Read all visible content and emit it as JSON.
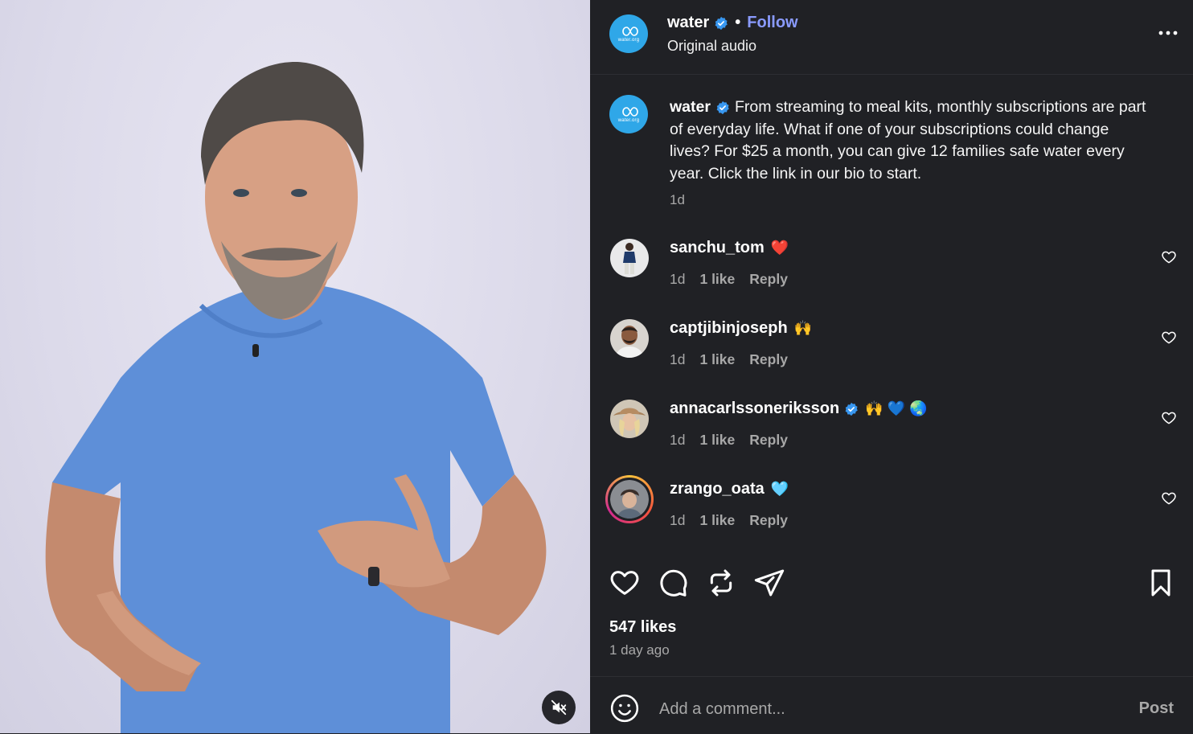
{
  "media": {
    "mute_icon": "speaker-muted-icon"
  },
  "header": {
    "username": "water",
    "separator": "•",
    "follow_label": "Follow",
    "audio": "Original audio",
    "avatar_wordmark": "water.org"
  },
  "caption": {
    "username": "water",
    "text": "From streaming to meal kits, monthly subscriptions are part of everyday life. What if one of your subscriptions could change lives? For $25 a month, you can give 12 families safe water every year. Click the link in our bio to start.",
    "time": "1d"
  },
  "comments": [
    {
      "username": "sanchu_tom",
      "text": "❤️",
      "time": "1d",
      "likes": "1 like",
      "reply": "Reply",
      "verified": false
    },
    {
      "username": "captjibinjoseph",
      "text": "🙌",
      "time": "1d",
      "likes": "1 like",
      "reply": "Reply",
      "verified": false
    },
    {
      "username": "annacarlssoneriksson",
      "text": "🙌 💙 🌏",
      "time": "1d",
      "likes": "1 like",
      "reply": "Reply",
      "verified": true
    },
    {
      "username": "zrango_oata",
      "text": "🩵",
      "time": "1d",
      "likes": "1 like",
      "reply": "Reply",
      "verified": false
    }
  ],
  "stats": {
    "likes": "547 likes",
    "posted": "1 day ago"
  },
  "composer": {
    "placeholder": "Add a comment...",
    "post_label": "Post"
  },
  "colors": {
    "panel_bg": "#202125",
    "accent_follow": "#8a9bff",
    "verified": "#3897f0",
    "brand_water": "#2fa7e8"
  }
}
